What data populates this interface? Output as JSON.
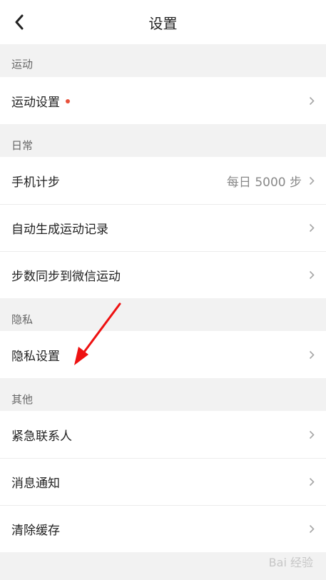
{
  "nav": {
    "title": "设置"
  },
  "sections": {
    "sport": {
      "header": "运动",
      "rows": [
        {
          "label": "运动设置"
        }
      ]
    },
    "daily": {
      "header": "日常",
      "rows": [
        {
          "label": "手机计步",
          "value": "每日 5000 步"
        },
        {
          "label": "自动生成运动记录"
        },
        {
          "label": "步数同步到微信运动"
        }
      ]
    },
    "privacy": {
      "header": "隐私",
      "rows": [
        {
          "label": "隐私设置"
        }
      ]
    },
    "other": {
      "header": "其他",
      "rows": [
        {
          "label": "紧急联系人"
        },
        {
          "label": "消息通知"
        },
        {
          "label": "清除缓存"
        }
      ]
    }
  },
  "colors": {
    "accent_dot": "#e8503a",
    "annotation_arrow": "#ee1111"
  },
  "watermark": "Bai 经验"
}
